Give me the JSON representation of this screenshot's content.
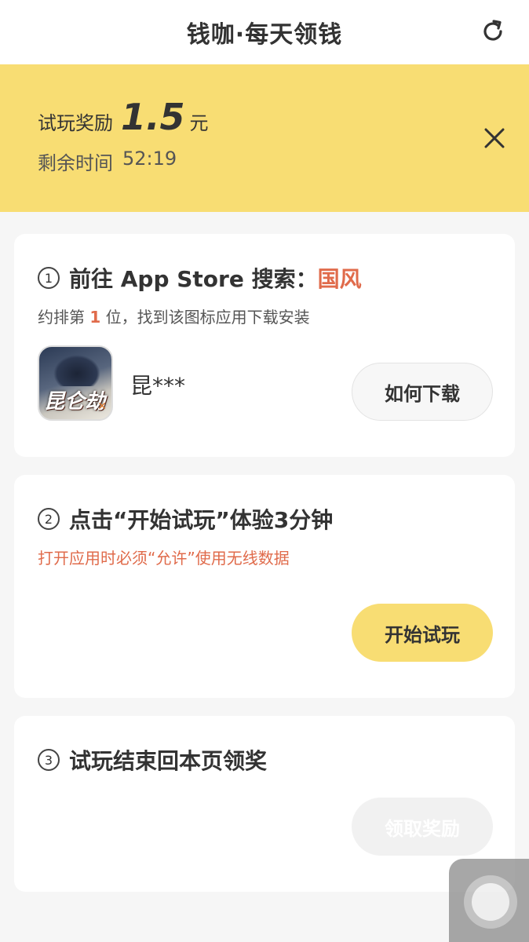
{
  "header": {
    "title": "钱咖·每天领钱",
    "refresh_icon": "refresh-icon"
  },
  "banner": {
    "reward_label": "试玩奖励",
    "reward_amount": "1.5",
    "reward_unit": "元",
    "timer_label": "剩余时间",
    "timer_value": "52:19",
    "close_icon": "close-icon",
    "bg_color": "#f8dd73"
  },
  "step1": {
    "number": "①",
    "title_prefix": "前往 App Store 搜索：",
    "keyword": "国风",
    "sub_prefix": "约排第 ",
    "rank": "1",
    "sub_suffix": " 位，找到该图标应用下载安装",
    "app_icon_text": "昆仑劫",
    "app_name": "昆***",
    "button_label": "如何下载"
  },
  "step2": {
    "number": "②",
    "title": "点击“开始试玩”体验3分钟",
    "warning": "打开应用时必须“允许”使用无线数据",
    "button_label": "开始试玩"
  },
  "step3": {
    "number": "③",
    "title": "试玩结束回本页领奖",
    "button_label": "领取奖励"
  },
  "colors": {
    "accent": "#f8dd73",
    "warning": "#e06b4b"
  }
}
